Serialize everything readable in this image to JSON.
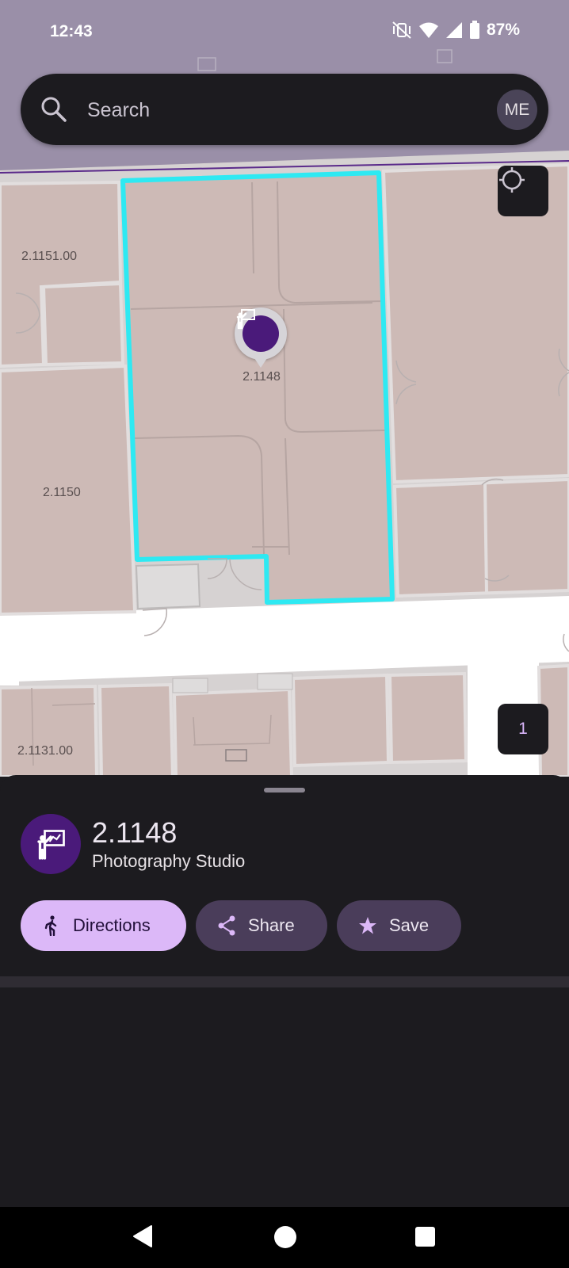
{
  "status_bar": {
    "time": "12:43",
    "battery": "87%",
    "icons": [
      "vibrate-off-icon",
      "wifi-icon",
      "signal-icon",
      "battery-icon"
    ]
  },
  "search": {
    "placeholder": "Search",
    "avatar_initials": "ME"
  },
  "map": {
    "rooms": [
      "2.1151.00",
      "2.1150",
      "2.1131.00"
    ],
    "selected_room_label": "2.1148",
    "floor": "1",
    "colors": {
      "room": "#cdbab6",
      "corridor": "#ffffff",
      "highlight": "#00e5ff",
      "outside": "#9a8fa8"
    }
  },
  "place": {
    "name": "2.1148",
    "category": "Photography Studio",
    "icon": "teacher-presentation-icon"
  },
  "actions": {
    "directions": "Directions",
    "share": "Share",
    "save": "Save"
  },
  "colors": {
    "accent": "#dcb8f8",
    "tonal_chip": "#4a3d5a",
    "place_icon_bg": "#4a1a7a",
    "surface": "#1c1b1f"
  }
}
